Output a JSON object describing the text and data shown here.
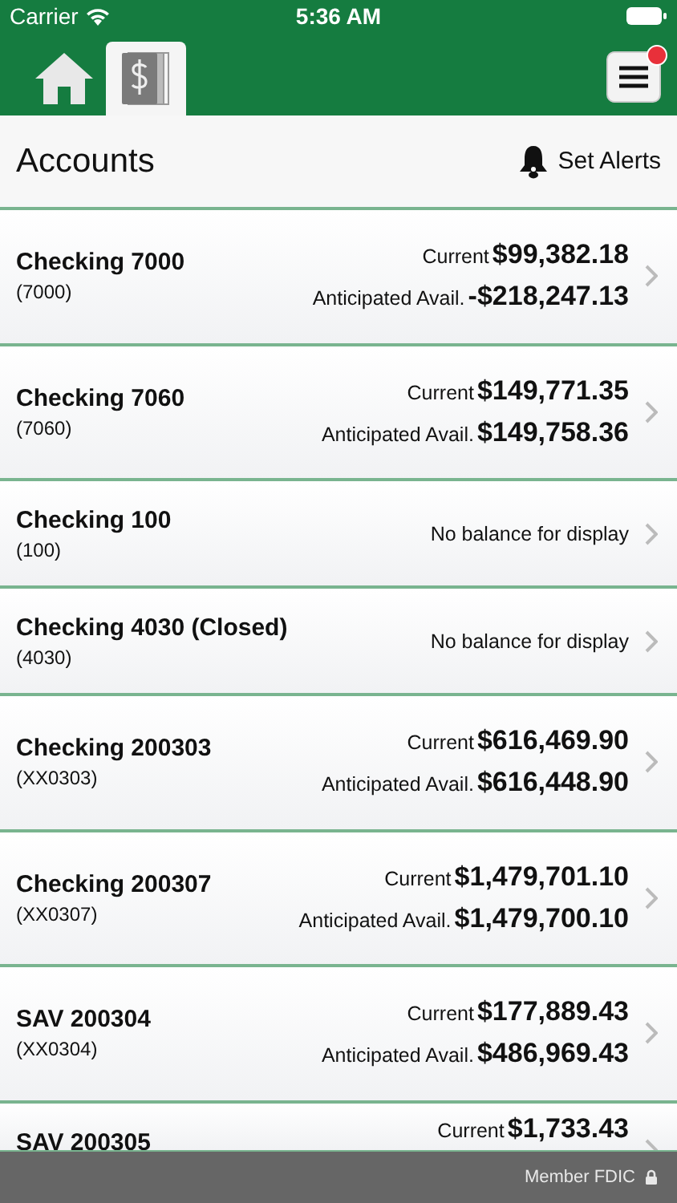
{
  "status_bar": {
    "carrier": "Carrier",
    "time": "5:36 AM"
  },
  "tabs": [
    {
      "kind": "home",
      "selected": false
    },
    {
      "kind": "accounts",
      "selected": true
    }
  ],
  "menu": {
    "notification": true
  },
  "header": {
    "title": "Accounts",
    "alerts_label": "Set Alerts"
  },
  "accounts": [
    {
      "kind": "balances",
      "name": "Checking 7000",
      "number": "(7000)",
      "balances": [
        {
          "label": "Current",
          "amount": "$99,382.18"
        },
        {
          "label": "Anticipated Avail.",
          "amount": "-$218,247.13"
        }
      ]
    },
    {
      "kind": "balances",
      "name": "Checking 7060",
      "number": "(7060)",
      "balances": [
        {
          "label": "Current",
          "amount": "$149,771.35"
        },
        {
          "label": "Anticipated Avail.",
          "amount": "$149,758.36"
        }
      ]
    },
    {
      "kind": "no_balance",
      "name": "Checking 100",
      "number": "(100)",
      "note": "No balance for display"
    },
    {
      "kind": "no_balance",
      "name": "Checking 4030 (Closed)",
      "number": "(4030)",
      "note": "No balance for display"
    },
    {
      "kind": "balances",
      "name": "Checking 200303",
      "number": "(XX0303)",
      "balances": [
        {
          "label": "Current",
          "amount": "$616,469.90"
        },
        {
          "label": "Anticipated Avail.",
          "amount": "$616,448.90"
        }
      ]
    },
    {
      "kind": "balances",
      "name": "Checking 200307",
      "number": "(XX0307)",
      "balances": [
        {
          "label": "Current",
          "amount": "$1,479,701.10"
        },
        {
          "label": "Anticipated Avail.",
          "amount": "$1,479,700.10"
        }
      ]
    },
    {
      "kind": "balances",
      "name": "SAV 200304",
      "number": "(XX0304)",
      "balances": [
        {
          "label": "Current",
          "amount": "$177,889.43"
        },
        {
          "label": "Anticipated Avail.",
          "amount": "$486,969.43"
        }
      ]
    },
    {
      "kind": "balances",
      "name": "SAV 200305",
      "balances": [
        {
          "label": "Current",
          "amount": "$1,733.43"
        }
      ]
    }
  ],
  "footer": {
    "text": "Member FDIC"
  }
}
